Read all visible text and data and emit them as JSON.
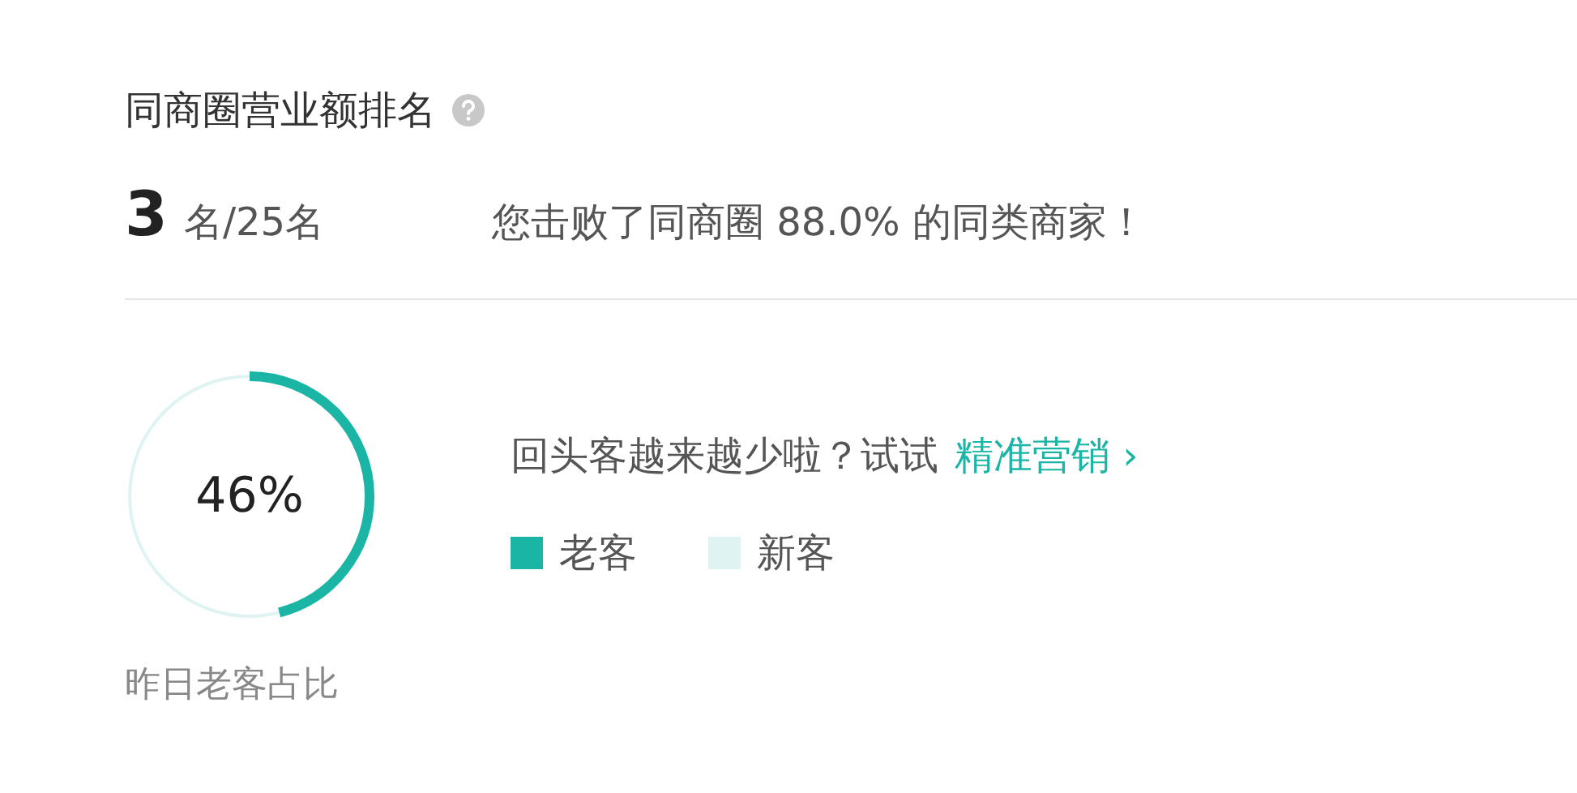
{
  "ranking": {
    "title": "同商圈营业额排名",
    "rank": "3",
    "rank_suffix": "名/25名",
    "summary": "您击败了同商圈 88.0% 的同类商家！"
  },
  "returning": {
    "level": 0.46,
    "percent": "46%",
    "caption": "昨日老客占比",
    "prompt": "回头客越来越少啦？试试",
    "link": "精准营销",
    "link_arrow": "›",
    "legend": [
      {
        "label": "老客",
        "color": "#1ab5a5"
      },
      {
        "label": "新客",
        "color": "#dff4f2"
      }
    ]
  }
}
